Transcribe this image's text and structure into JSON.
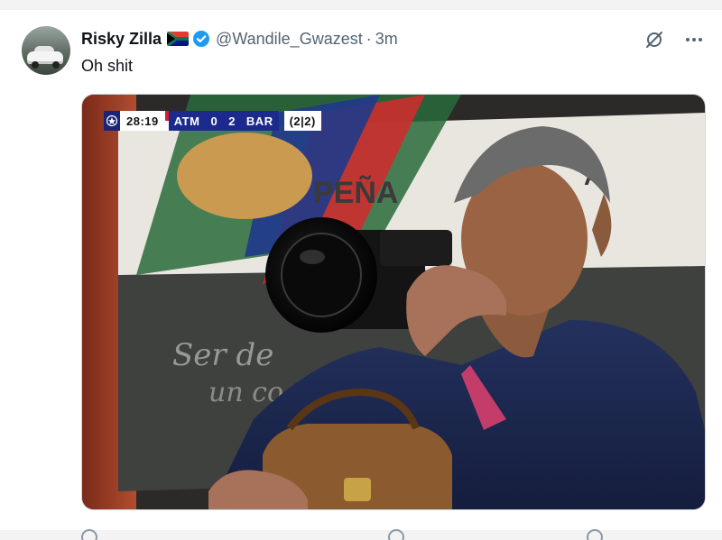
{
  "post": {
    "display_name": "Risky Zilla",
    "flag": "south-africa-flag",
    "handle": "@Wandile_Gwazest",
    "separator": "·",
    "time": "3m",
    "text": "Oh shit",
    "icons": {
      "verified": "verified-badge-icon",
      "grok": "grok-icon",
      "more": "more-icon"
    }
  },
  "scorebug": {
    "clock": "28:19",
    "home": "ATM",
    "home_score": "0",
    "away_score": "2",
    "away": "BAR",
    "aggregate": "(2|2)"
  },
  "colors": {
    "accent": "#1d9bf0",
    "muted_text": "#536471",
    "scorebug_blue": "#1b2a8c"
  }
}
